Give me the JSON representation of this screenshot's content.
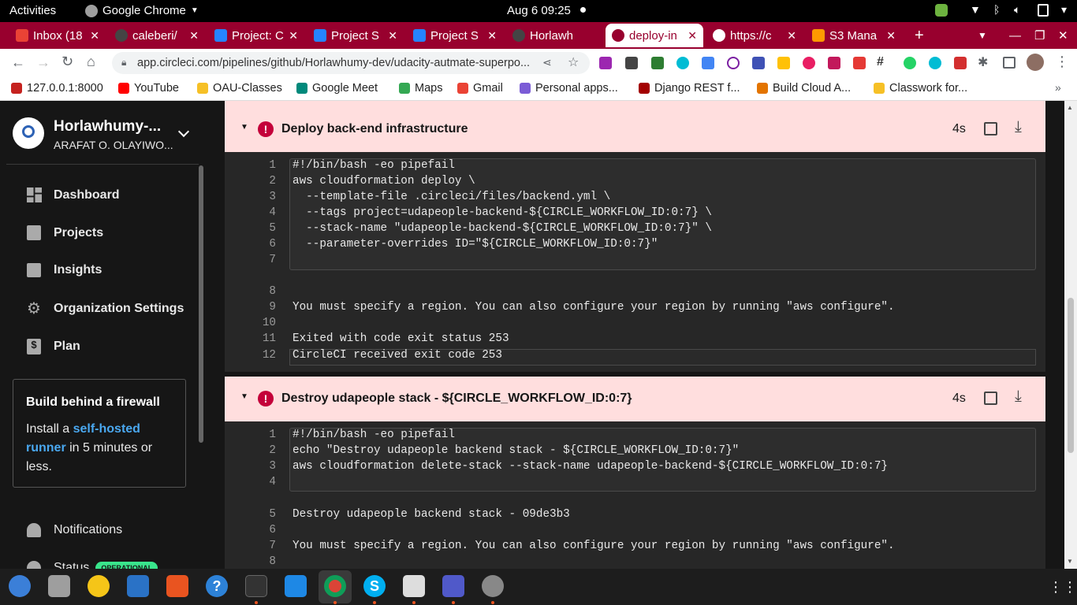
{
  "system": {
    "activities": "Activities",
    "app_name": "Google Chrome",
    "datetime": "Aug 6  09:25"
  },
  "tabs": [
    {
      "label": "Inbox (18",
      "color": "#ea4335"
    },
    {
      "label": "caleberi/",
      "color": "#444444"
    },
    {
      "label": "Project: C",
      "color": "#2684ff"
    },
    {
      "label": "Project S",
      "color": "#2684ff"
    },
    {
      "label": "Project S",
      "color": "#2684ff"
    },
    {
      "label": "Horlawh",
      "color": "#444444"
    },
    {
      "label": "deploy-in",
      "color": "#98002e"
    },
    {
      "label": "https://c",
      "color": "#5f6368"
    },
    {
      "label": "S3 Mana",
      "color": "#ff9900"
    }
  ],
  "omnibox": {
    "url": "app.circleci.com/pipelines/github/Horlawhumy-dev/udacity-autmate-superpo..."
  },
  "bookmarks": [
    {
      "label": "127.0.0.1:8000",
      "color": "#c5221f"
    },
    {
      "label": "YouTube",
      "color": "#ff0000"
    },
    {
      "label": "OAU-Classes",
      "color": "#f6c026"
    },
    {
      "label": "Google Meet",
      "color": "#00897b"
    },
    {
      "label": "Maps",
      "color": "#34a853"
    },
    {
      "label": "Gmail",
      "color": "#ea4335"
    },
    {
      "label": "Personal apps...",
      "color": "#7b5cd6"
    },
    {
      "label": "Django REST f...",
      "color": "#a30000"
    },
    {
      "label": "Build Cloud A...",
      "color": "#e37400"
    },
    {
      "label": "Classwork for...",
      "color": "#f6c026"
    }
  ],
  "sidebar": {
    "org_name": "Horlawhumy-...",
    "org_user": "ARAFAT O. OLAYIWO...",
    "nav": [
      "Dashboard",
      "Projects",
      "Insights",
      "Organization Settings",
      "Plan"
    ],
    "promo": {
      "title": "Build behind a firewall",
      "text_before": "Install a",
      "link": "self-hosted runner",
      "text_after": "in 5 minutes or less."
    },
    "notifications": "Notifications",
    "status": "Status",
    "status_badge": "OPERATIONAL"
  },
  "steps": [
    {
      "title": "Deploy back-end infrastructure",
      "duration": "4s",
      "script": [
        "#!/bin/bash -eo pipefail",
        "aws cloudformation deploy \\",
        "  --template-file .circleci/files/backend.yml \\",
        "  --tags project=udapeople-backend-${CIRCLE_WORKFLOW_ID:0:7} \\",
        "  --stack-name \"udapeople-backend-${CIRCLE_WORKFLOW_ID:0:7}\" \\",
        "  --parameter-overrides ID=\"${CIRCLE_WORKFLOW_ID:0:7}\"",
        ""
      ],
      "output": [
        "",
        "You must specify a region. You can also configure your region by running \"aws configure\".",
        "",
        "Exited with code exit status 253",
        "CircleCI received exit code 253"
      ]
    },
    {
      "title": "Destroy udapeople stack - ${CIRCLE_WORKFLOW_ID:0:7}",
      "duration": "4s",
      "script": [
        "#!/bin/bash -eo pipefail",
        "echo \"Destroy udapeople backend stack - ${CIRCLE_WORKFLOW_ID:0:7}\"",
        "aws cloudformation delete-stack --stack-name udapeople-backend-${CIRCLE_WORKFLOW_ID:0:7}",
        ""
      ],
      "output": [
        "Destroy udapeople backend stack - 09de3b3",
        "",
        "You must specify a region. You can also configure your region by running \"aws configure\".",
        ""
      ]
    }
  ],
  "line_numbers": [
    "1",
    "2",
    "3",
    "4",
    "5",
    "6",
    "7",
    "8",
    "9",
    "10",
    "11",
    "12"
  ],
  "icons": [
    "gmail-icon",
    "github-icon",
    "jira-icon",
    "circleci-icon",
    "globe-icon",
    "aws-icon",
    "back-icon",
    "forward-icon",
    "reload-icon",
    "home-icon",
    "share-icon",
    "star-icon",
    "extensions-icon",
    "chevron-down-icon",
    "error-icon",
    "open-external-icon",
    "download-icon",
    "bell-icon",
    "dashboard-icon",
    "projects-icon",
    "insights-icon",
    "gear-icon",
    "plan-icon"
  ]
}
